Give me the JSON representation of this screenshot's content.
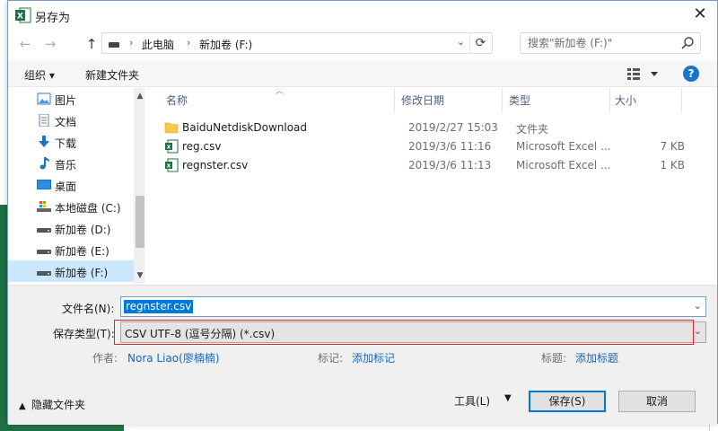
{
  "window": {
    "title": "另存为"
  },
  "nav": {
    "back": "←",
    "forward": "→",
    "up": "↑"
  },
  "address": {
    "crumbs": [
      "此电脑",
      "新加卷 (F:)"
    ],
    "sep": "›",
    "dropdown": "⌄",
    "refresh": "⟳"
  },
  "search": {
    "placeholder": "搜索\"新加卷 (F:)\""
  },
  "toolbar": {
    "organize": "组织 ▾",
    "new_folder": "新建文件夹",
    "help": "?"
  },
  "sidebar": {
    "items": [
      {
        "label": "图片",
        "icon": "pictures-icon"
      },
      {
        "label": "文档",
        "icon": "documents-icon"
      },
      {
        "label": "下载",
        "icon": "downloads-icon"
      },
      {
        "label": "音乐",
        "icon": "music-icon"
      },
      {
        "label": "桌面",
        "icon": "desktop-icon"
      },
      {
        "label": "本地磁盘 (C:)",
        "icon": "local-disk-icon"
      },
      {
        "label": "新加卷 (D:)",
        "icon": "drive-icon"
      },
      {
        "label": "新加卷 (E:)",
        "icon": "drive-icon"
      },
      {
        "label": "新加卷 (F:)",
        "icon": "drive-icon",
        "selected": true
      }
    ]
  },
  "filelist": {
    "columns": [
      "名称",
      "修改日期",
      "类型",
      "大小"
    ],
    "rows": [
      {
        "name": "BaiduNetdiskDownload",
        "date": "2019/2/27 15:03",
        "type": "文件夹",
        "size": "",
        "icon": "folder-icon"
      },
      {
        "name": "reg.csv",
        "date": "2019/3/6 11:16",
        "type": "Microsoft Excel ...",
        "size": "7 KB",
        "icon": "excel-csv-icon"
      },
      {
        "name": "regnster.csv",
        "date": "2019/3/6 11:13",
        "type": "Microsoft Excel ...",
        "size": "1 KB",
        "icon": "excel-csv-icon"
      }
    ]
  },
  "form": {
    "filename_label": "文件名(N):",
    "filename_value": "regnster.csv",
    "filetype_label": "保存类型(T):",
    "filetype_value": "CSV UTF-8 (逗号分隔) (*.csv)",
    "author_label": "作者:",
    "author_value": "Nora Liao(廖楠楠)",
    "tags_label": "标记:",
    "tags_value": "添加标记",
    "title_label": "标题:",
    "title_value": "添加标题"
  },
  "footer": {
    "hide_folders": "隐藏文件夹",
    "tools": "工具(L)",
    "tools_dropdown": "▼",
    "save": "保存(S)",
    "cancel": "取消"
  },
  "colors": {
    "accent": "#0078d7",
    "highlight": "#e0242a",
    "link": "#1a66b8",
    "excel_green": "#1e7145"
  }
}
